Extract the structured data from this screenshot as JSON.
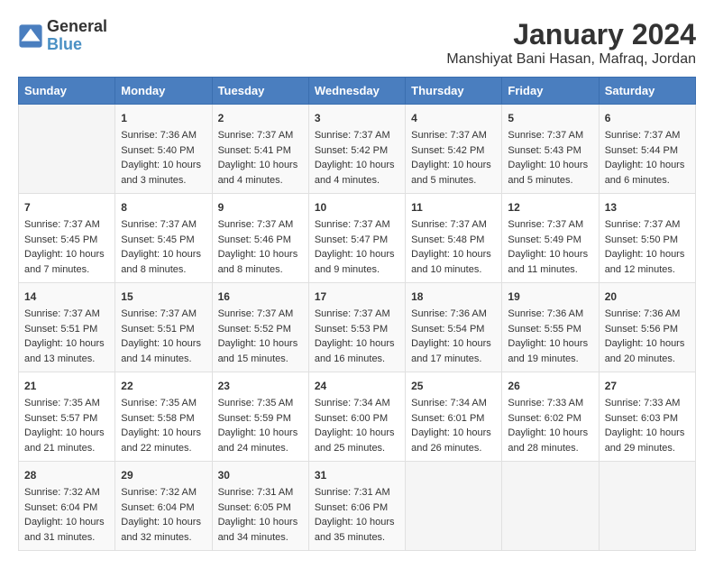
{
  "header": {
    "logo_general": "General",
    "logo_blue": "Blue",
    "title": "January 2024",
    "location": "Manshiyat Bani Hasan, Mafraq, Jordan"
  },
  "weekdays": [
    "Sunday",
    "Monday",
    "Tuesday",
    "Wednesday",
    "Thursday",
    "Friday",
    "Saturday"
  ],
  "weeks": [
    [
      {
        "day": "",
        "info": ""
      },
      {
        "day": "1",
        "info": "Sunrise: 7:36 AM\nSunset: 5:40 PM\nDaylight: 10 hours\nand 3 minutes."
      },
      {
        "day": "2",
        "info": "Sunrise: 7:37 AM\nSunset: 5:41 PM\nDaylight: 10 hours\nand 4 minutes."
      },
      {
        "day": "3",
        "info": "Sunrise: 7:37 AM\nSunset: 5:42 PM\nDaylight: 10 hours\nand 4 minutes."
      },
      {
        "day": "4",
        "info": "Sunrise: 7:37 AM\nSunset: 5:42 PM\nDaylight: 10 hours\nand 5 minutes."
      },
      {
        "day": "5",
        "info": "Sunrise: 7:37 AM\nSunset: 5:43 PM\nDaylight: 10 hours\nand 5 minutes."
      },
      {
        "day": "6",
        "info": "Sunrise: 7:37 AM\nSunset: 5:44 PM\nDaylight: 10 hours\nand 6 minutes."
      }
    ],
    [
      {
        "day": "7",
        "info": "Sunrise: 7:37 AM\nSunset: 5:45 PM\nDaylight: 10 hours\nand 7 minutes."
      },
      {
        "day": "8",
        "info": "Sunrise: 7:37 AM\nSunset: 5:45 PM\nDaylight: 10 hours\nand 8 minutes."
      },
      {
        "day": "9",
        "info": "Sunrise: 7:37 AM\nSunset: 5:46 PM\nDaylight: 10 hours\nand 8 minutes."
      },
      {
        "day": "10",
        "info": "Sunrise: 7:37 AM\nSunset: 5:47 PM\nDaylight: 10 hours\nand 9 minutes."
      },
      {
        "day": "11",
        "info": "Sunrise: 7:37 AM\nSunset: 5:48 PM\nDaylight: 10 hours\nand 10 minutes."
      },
      {
        "day": "12",
        "info": "Sunrise: 7:37 AM\nSunset: 5:49 PM\nDaylight: 10 hours\nand 11 minutes."
      },
      {
        "day": "13",
        "info": "Sunrise: 7:37 AM\nSunset: 5:50 PM\nDaylight: 10 hours\nand 12 minutes."
      }
    ],
    [
      {
        "day": "14",
        "info": "Sunrise: 7:37 AM\nSunset: 5:51 PM\nDaylight: 10 hours\nand 13 minutes."
      },
      {
        "day": "15",
        "info": "Sunrise: 7:37 AM\nSunset: 5:51 PM\nDaylight: 10 hours\nand 14 minutes."
      },
      {
        "day": "16",
        "info": "Sunrise: 7:37 AM\nSunset: 5:52 PM\nDaylight: 10 hours\nand 15 minutes."
      },
      {
        "day": "17",
        "info": "Sunrise: 7:37 AM\nSunset: 5:53 PM\nDaylight: 10 hours\nand 16 minutes."
      },
      {
        "day": "18",
        "info": "Sunrise: 7:36 AM\nSunset: 5:54 PM\nDaylight: 10 hours\nand 17 minutes."
      },
      {
        "day": "19",
        "info": "Sunrise: 7:36 AM\nSunset: 5:55 PM\nDaylight: 10 hours\nand 19 minutes."
      },
      {
        "day": "20",
        "info": "Sunrise: 7:36 AM\nSunset: 5:56 PM\nDaylight: 10 hours\nand 20 minutes."
      }
    ],
    [
      {
        "day": "21",
        "info": "Sunrise: 7:35 AM\nSunset: 5:57 PM\nDaylight: 10 hours\nand 21 minutes."
      },
      {
        "day": "22",
        "info": "Sunrise: 7:35 AM\nSunset: 5:58 PM\nDaylight: 10 hours\nand 22 minutes."
      },
      {
        "day": "23",
        "info": "Sunrise: 7:35 AM\nSunset: 5:59 PM\nDaylight: 10 hours\nand 24 minutes."
      },
      {
        "day": "24",
        "info": "Sunrise: 7:34 AM\nSunset: 6:00 PM\nDaylight: 10 hours\nand 25 minutes."
      },
      {
        "day": "25",
        "info": "Sunrise: 7:34 AM\nSunset: 6:01 PM\nDaylight: 10 hours\nand 26 minutes."
      },
      {
        "day": "26",
        "info": "Sunrise: 7:33 AM\nSunset: 6:02 PM\nDaylight: 10 hours\nand 28 minutes."
      },
      {
        "day": "27",
        "info": "Sunrise: 7:33 AM\nSunset: 6:03 PM\nDaylight: 10 hours\nand 29 minutes."
      }
    ],
    [
      {
        "day": "28",
        "info": "Sunrise: 7:32 AM\nSunset: 6:04 PM\nDaylight: 10 hours\nand 31 minutes."
      },
      {
        "day": "29",
        "info": "Sunrise: 7:32 AM\nSunset: 6:04 PM\nDaylight: 10 hours\nand 32 minutes."
      },
      {
        "day": "30",
        "info": "Sunrise: 7:31 AM\nSunset: 6:05 PM\nDaylight: 10 hours\nand 34 minutes."
      },
      {
        "day": "31",
        "info": "Sunrise: 7:31 AM\nSunset: 6:06 PM\nDaylight: 10 hours\nand 35 minutes."
      },
      {
        "day": "",
        "info": ""
      },
      {
        "day": "",
        "info": ""
      },
      {
        "day": "",
        "info": ""
      }
    ]
  ]
}
